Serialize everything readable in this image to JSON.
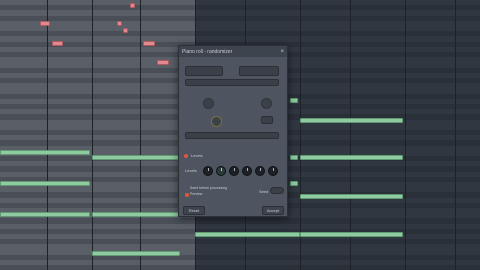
{
  "dialog": {
    "title": "Piano roll - randomizer",
    "close_label": "×",
    "group_label": "Levels",
    "levels_label": "Levels",
    "option_label": "Seed before processing",
    "option2_label": "Preview",
    "seed_label": "Seed",
    "reset_label": "Reset",
    "accept_label": "Accept"
  },
  "colors": {
    "note_green": "#8fcaa0",
    "note_pink": "#e08a8f",
    "accent_knob": "#7de0c0",
    "led_red": "#e0563a"
  },
  "icons": [
    "close-icon",
    "knob-icon",
    "led-indicator-icon",
    "toggle-icon"
  ]
}
